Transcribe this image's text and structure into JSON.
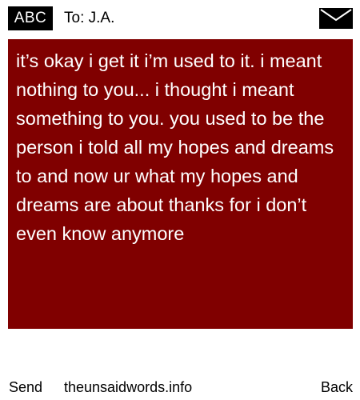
{
  "header": {
    "input_mode": "ABC",
    "recipient": "To: J.A.",
    "envelope_icon": "envelope-icon"
  },
  "message": {
    "text": "it’s okay i get it i’m used to it. i meant nothing to you... i thought i meant something to you. you used to be the person i told all my hopes and dreams to and now ur what my hopes and dreams are about thanks for i don’t even know anymore"
  },
  "footer": {
    "send_label": "Send",
    "site_label": "theunsaidwords.info",
    "back_label": "Back"
  },
  "colors": {
    "message_background": "#800000",
    "message_text": "#ffffff",
    "page_background": "#ffffff",
    "badge_background": "#000000"
  }
}
